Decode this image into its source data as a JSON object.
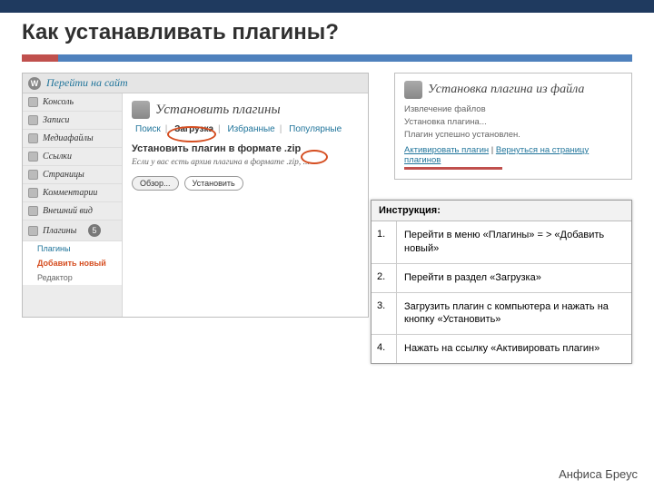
{
  "slide": {
    "title": "Как устанавливать плагины?",
    "footer_author": "Анфиса Бреус"
  },
  "wp": {
    "site_link": "Перейти на сайт",
    "logo_letter": "W",
    "sidebar": [
      {
        "label": "Консоль"
      },
      {
        "label": "Записи"
      },
      {
        "label": "Медиафайлы"
      },
      {
        "label": "Ссылки"
      },
      {
        "label": "Страницы"
      },
      {
        "label": "Комментарии"
      },
      {
        "label": "Внешний вид"
      },
      {
        "label": "Плагины",
        "badge": "5"
      },
      {
        "label": "Редактор"
      }
    ],
    "plugins_sub": {
      "item1": "Плагины",
      "item2": "Добавить новый"
    },
    "install": {
      "heading": "Установить плагины",
      "tabs": {
        "search": "Поиск",
        "upload": "Загрузка",
        "featured": "Избранные",
        "popular": "Популярные"
      },
      "sub_heading": "Установить плагин в формате .zip",
      "desc": "Если у вас есть архив плагина в формате .zip, ...",
      "browse": "Обзор...",
      "install_btn": "Установить"
    },
    "activate": {
      "heading": "Установка плагина из файла",
      "line1": "Извлечение файлов",
      "line2": "Установка плагина...",
      "line3": "Плагин успешно установлен.",
      "link_activate": "Активировать плагин",
      "link_sep": " | ",
      "link_back": "Вернуться на страницу плагинов"
    }
  },
  "instructions": {
    "heading": "Инструкция:",
    "steps": [
      {
        "n": "1.",
        "text": "Перейти в меню «Плагины» = > «Добавить новый»"
      },
      {
        "n": "2.",
        "text": "Перейти в раздел «Загрузка»"
      },
      {
        "n": "3.",
        "text": "Загрузить плагин с компьютера и нажать на кнопку «Установить»"
      },
      {
        "n": "4.",
        "text": "Нажать на ссылку «Активировать плагин»"
      }
    ]
  }
}
